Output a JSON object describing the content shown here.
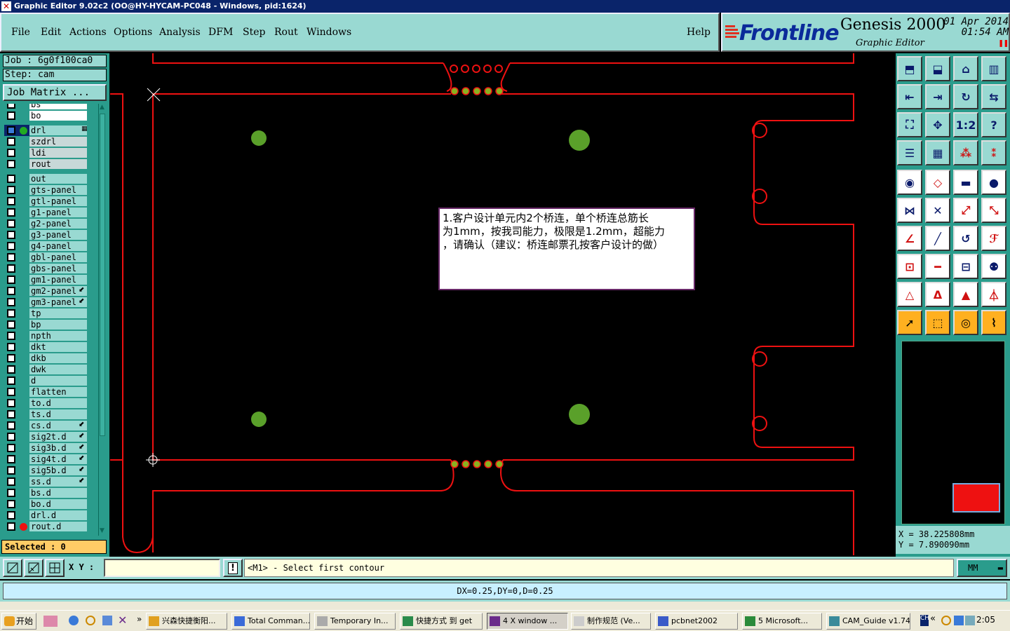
{
  "window": {
    "title": "Graphic Editor 9.02c2 (OO@HY-HYCAM-PC048 - Windows, pid:1624)"
  },
  "menu": {
    "items": [
      "File",
      "Edit",
      "Actions",
      "Options",
      "Analysis",
      "DFM",
      "Step",
      "Rout",
      "Windows"
    ],
    "help": "Help"
  },
  "brand": {
    "name": "Frontline",
    "product": "Genesis 2000",
    "subtitle": "Graphic Editor",
    "date": "01 Apr 2014",
    "time": "01:54 AM",
    "colors": {
      "red": "#e03020",
      "blue": "#0a2a9a"
    }
  },
  "job": {
    "job_label": "Job : 6g0f100ca0",
    "step_label": "Step: cam",
    "matrix_button": "Job Matrix ..."
  },
  "layers": [
    {
      "name": "bs",
      "style": "white",
      "group": 0
    },
    {
      "name": "bo",
      "style": "white",
      "group": 0
    },
    {
      "name": "drl",
      "style": "teal",
      "group": 1,
      "selected": true,
      "dot": "#22aa22"
    },
    {
      "name": "szdrl",
      "style": "gray",
      "group": 1
    },
    {
      "name": "ldi",
      "style": "gray",
      "group": 1
    },
    {
      "name": "rout",
      "style": "gray",
      "group": 1
    },
    {
      "name": "out",
      "style": "teal",
      "group": 2
    },
    {
      "name": "gts-panel",
      "style": "teal",
      "group": 2
    },
    {
      "name": "gtl-panel",
      "style": "teal",
      "group": 2
    },
    {
      "name": "g1-panel",
      "style": "teal",
      "group": 2
    },
    {
      "name": "g2-panel",
      "style": "teal",
      "group": 2
    },
    {
      "name": "g3-panel",
      "style": "teal",
      "group": 2
    },
    {
      "name": "g4-panel",
      "style": "teal",
      "group": 2
    },
    {
      "name": "gbl-panel",
      "style": "teal",
      "group": 2
    },
    {
      "name": "gbs-panel",
      "style": "teal",
      "group": 2
    },
    {
      "name": "gm1-panel",
      "style": "teal",
      "group": 2
    },
    {
      "name": "gm2-panel",
      "style": "teal",
      "group": 2,
      "flag": true
    },
    {
      "name": "gm3-panel",
      "style": "teal",
      "group": 2,
      "flag": true
    },
    {
      "name": "tp",
      "style": "teal",
      "group": 2
    },
    {
      "name": "bp",
      "style": "teal",
      "group": 2
    },
    {
      "name": "npth",
      "style": "teal",
      "group": 2
    },
    {
      "name": "dkt",
      "style": "teal",
      "group": 2
    },
    {
      "name": "dkb",
      "style": "teal",
      "group": 2
    },
    {
      "name": "dwk",
      "style": "teal",
      "group": 2
    },
    {
      "name": "d",
      "style": "teal",
      "group": 2
    },
    {
      "name": "flatten",
      "style": "teal",
      "group": 2
    },
    {
      "name": "to.d",
      "style": "teal",
      "group": 2
    },
    {
      "name": "ts.d",
      "style": "teal",
      "group": 2
    },
    {
      "name": "cs.d",
      "style": "teal",
      "group": 2,
      "flag": true
    },
    {
      "name": "sig2t.d",
      "style": "teal",
      "group": 2,
      "flag": true
    },
    {
      "name": "sig3b.d",
      "style": "teal",
      "group": 2,
      "flag": true
    },
    {
      "name": "sig4t.d",
      "style": "teal",
      "group": 2,
      "flag": true
    },
    {
      "name": "sig5b.d",
      "style": "teal",
      "group": 2,
      "flag": true
    },
    {
      "name": "ss.d",
      "style": "teal",
      "group": 2,
      "flag": true
    },
    {
      "name": "bs.d",
      "style": "teal",
      "group": 2
    },
    {
      "name": "bo.d",
      "style": "teal",
      "group": 2
    },
    {
      "name": "drl.d",
      "style": "teal",
      "group": 2
    },
    {
      "name": "rout.d",
      "style": "teal",
      "group": 2,
      "dot": "#ee1111"
    }
  ],
  "selected_label": "Selected : 0",
  "note": {
    "line1": "1.客户设计单元内2个桥连，单个桥连总筋长",
    "line2": "为1mm，按我司能力，极限是1.2mm，超能力",
    "line3": "，请确认（建议：桥连邮票孔按客户设计的做）"
  },
  "coords": {
    "x": "X  =  38.225808mm",
    "y": "Y  =  7.890090mm"
  },
  "command": {
    "xy_label": "X Y :",
    "prompt": "<M1> - Select first contour",
    "units": "MM"
  },
  "measure": "DX=0.25,DY=0,D=0.25",
  "taskbar": {
    "start": "开始",
    "buttons": [
      "兴森快捷衡阳...",
      "Total Comman...",
      "Temporary In...",
      "快捷方式 到 get",
      "4 X window ...",
      "制作规范 (Ve...",
      "pcbnet2002",
      "5 Microsoft...",
      "CAM_Guide v1.74"
    ],
    "clock": "2:05"
  },
  "icons": {
    "file_menu": "window-icon",
    "toolbar": [
      "zoom-home-icon",
      "zoom-down-icon",
      "house-icon",
      "panel-icon",
      "move-left-icon",
      "move-right-icon",
      "rotate-icon",
      "swap-icon",
      "fit-icon",
      "center-icon",
      "scale-icon",
      "help-icon",
      "layers-tool-icon",
      "grid-icon",
      "snap-red-icon",
      "snap-red2-icon"
    ]
  }
}
